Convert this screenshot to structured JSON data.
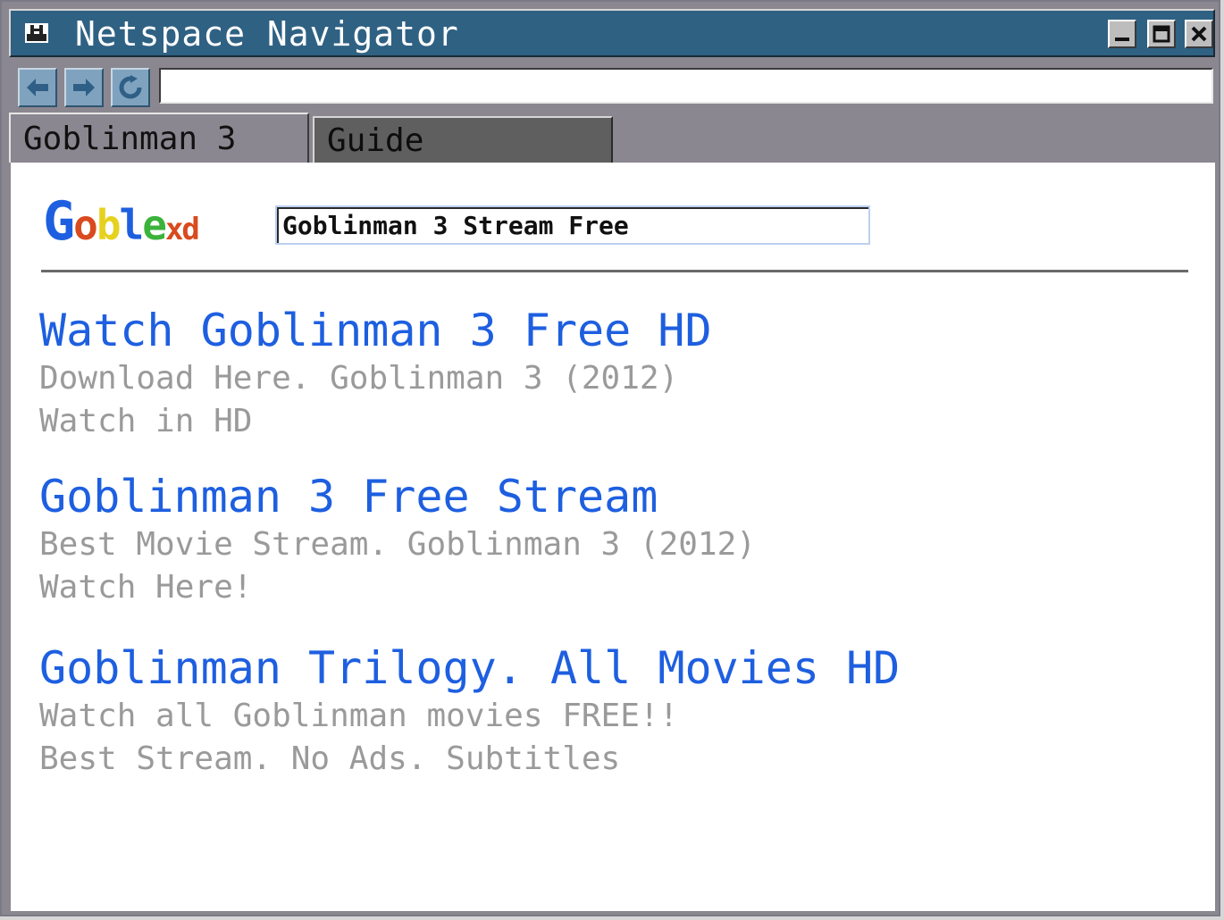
{
  "window": {
    "title": "Netspace Navigator",
    "title_bar_color": "#2f6183"
  },
  "toolbar": {
    "back_icon": "arrow-left-icon",
    "forward_icon": "arrow-right-icon",
    "reload_icon": "reload-icon",
    "address_value": ""
  },
  "tabs": [
    {
      "label": "Goblinman 3",
      "active": true
    },
    {
      "label": "Guide",
      "active": false
    }
  ],
  "search_page": {
    "logo_letters": [
      {
        "char": "G",
        "color": "#1e5fe0"
      },
      {
        "char": "o",
        "color": "#d94a1e"
      },
      {
        "char": "b",
        "color": "#e6d21e"
      },
      {
        "char": "l",
        "color": "#1e5fe0"
      },
      {
        "char": "e",
        "color": "#3bb33b"
      },
      {
        "char": "x",
        "color": "#d94a1e"
      },
      {
        "char": "d",
        "color": "#d94a1e"
      }
    ],
    "query": "Goblinman 3 Stream Free",
    "results": [
      {
        "title": "Watch Goblinman 3 Free HD",
        "desc_line1": "Download Here. Goblinman 3 (2012)",
        "desc_line2": "Watch in HD"
      },
      {
        "title": "Goblinman 3 Free Stream",
        "desc_line1": "Best Movie Stream. Goblinman 3 (2012)",
        "desc_line2": "Watch Here!"
      },
      {
        "title": "Goblinman Trilogy. All Movies HD",
        "desc_line1": "Watch all Goblinman movies FREE!!",
        "desc_line2": "Best Stream. No Ads. Subtitles"
      }
    ],
    "link_color": "#1e5fe0",
    "desc_color": "#9a9a9a"
  }
}
